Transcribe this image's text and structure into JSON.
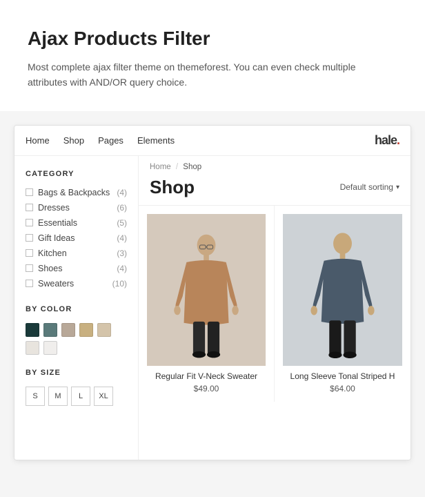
{
  "hero": {
    "title": "Ajax Products Filter",
    "description": "Most complete ajax filter theme on themeforest. You can even check multiple attributes with AND/OR query choice."
  },
  "nav": {
    "links": [
      "Home",
      "Shop",
      "Pages",
      "Elements"
    ],
    "logo": "hale"
  },
  "sidebar": {
    "category_label": "CATEGORY",
    "categories": [
      {
        "name": "Bags & Backpacks",
        "count": "(4)"
      },
      {
        "name": "Dresses",
        "count": "(6)"
      },
      {
        "name": "Essentials",
        "count": "(5)"
      },
      {
        "name": "Gift Ideas",
        "count": "(4)"
      },
      {
        "name": "Kitchen",
        "count": "(3)"
      },
      {
        "name": "Shoes",
        "count": "(4)"
      },
      {
        "name": "Sweaters",
        "count": "(10)"
      }
    ],
    "color_label": "BY COLOR",
    "colors": [
      {
        "hex": "#1a3a3a",
        "selected": false
      },
      {
        "hex": "#4a6a6a",
        "selected": false
      },
      {
        "hex": "#b8a898",
        "selected": false
      },
      {
        "hex": "#c8b89a",
        "selected": false
      },
      {
        "hex": "#d4c4aa",
        "selected": false
      },
      {
        "hex": "#e8e4de",
        "selected": false
      },
      {
        "hex": "#f0eeec",
        "selected": false
      }
    ],
    "size_label": "BY SIZE",
    "sizes": [
      "S",
      "M",
      "L",
      "XL"
    ]
  },
  "shop": {
    "breadcrumb_home": "Home",
    "breadcrumb_sep": "/",
    "breadcrumb_current": "Shop",
    "title": "Shop",
    "sort_label": "Default sorting",
    "products": [
      {
        "name": "Regular Fit V-Neck Sweater",
        "price": "$49.00"
      },
      {
        "name": "Long Sleeve Tonal Striped H",
        "price": "$64.00"
      }
    ]
  }
}
